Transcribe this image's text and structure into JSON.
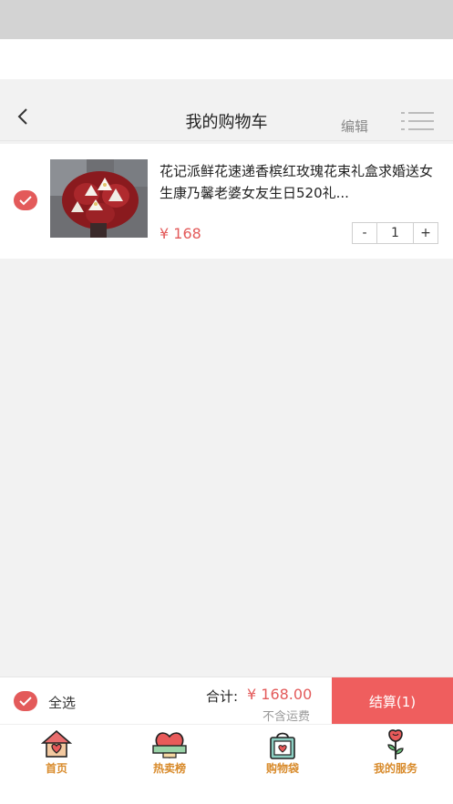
{
  "header": {
    "title": "我的购物车",
    "edit_label": "编辑"
  },
  "cart": {
    "items": [
      {
        "title": "花记派鲜花速递香槟红玫瑰花束礼盒求婚送女生康乃馨老婆女友生日520礼...",
        "price": "¥ 168",
        "quantity": "1",
        "minus_label": "-",
        "plus_label": "+",
        "selected": true
      }
    ]
  },
  "footer": {
    "select_all_label": "全选",
    "total_label": "合计:",
    "total_value": "¥ 168.00",
    "shipping_note": "不含运费",
    "checkout_label": "结算(1)"
  },
  "tabbar": {
    "items": [
      {
        "label": "首页",
        "icon": "house-icon"
      },
      {
        "label": "热卖榜",
        "icon": "heart-ribbon-icon"
      },
      {
        "label": "购物袋",
        "icon": "shopping-bag-icon"
      },
      {
        "label": "我的服务",
        "icon": "rose-icon"
      }
    ]
  },
  "colors": {
    "accent": "#e35a5a",
    "checkout_button": "#ef5e5e",
    "tab_label": "#d88a2a"
  }
}
